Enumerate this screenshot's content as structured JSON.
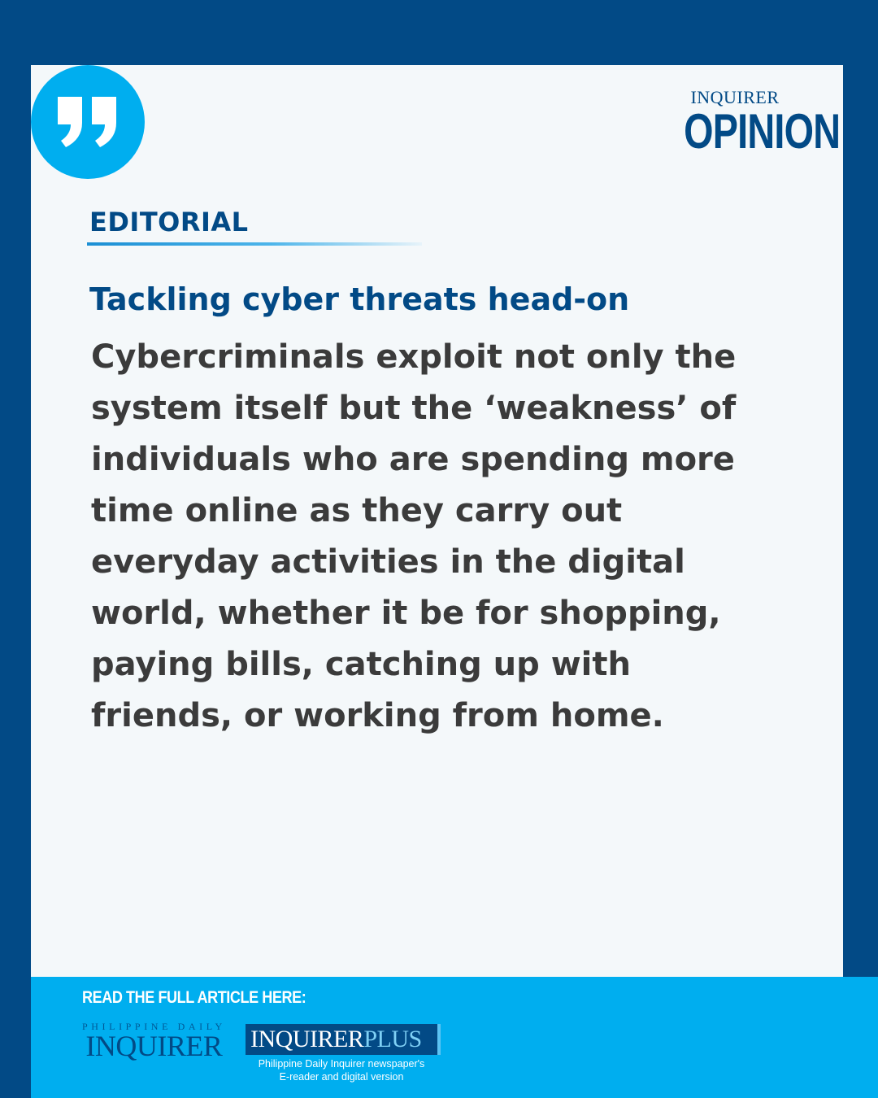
{
  "brand": {
    "top": "INQUIRER",
    "main": "OPINION"
  },
  "section_label": "EDITORIAL",
  "headline": "Tackling cyber threats head-on",
  "excerpt_lines": [
    "Cybercriminals exploit not only the",
    "system itself but the ‘weakness’ of",
    "individuals who are spending more",
    "time online as they carry out",
    "everyday activities in the digital",
    "world, whether it be for shopping,",
    "paying bills, catching up with",
    "friends, or working from home."
  ],
  "footer": {
    "cta": "READ THE FULL ARTICLE HERE:",
    "pdi_small": "PHILIPPINE DAILY",
    "pdi_big": "INQUIRER",
    "plus_a": "INQUIRER",
    "plus_b": "PLUS",
    "plus_caption_1": "Philippine Daily Inquirer newspaper's",
    "plus_caption_2": "E-reader and digital version"
  },
  "colors": {
    "frame": "#024a86",
    "accent": "#00aeef",
    "card": "#f4f8fa",
    "body_text": "#3b3b3b"
  },
  "icons": {
    "quote": "closing-quote-icon"
  }
}
